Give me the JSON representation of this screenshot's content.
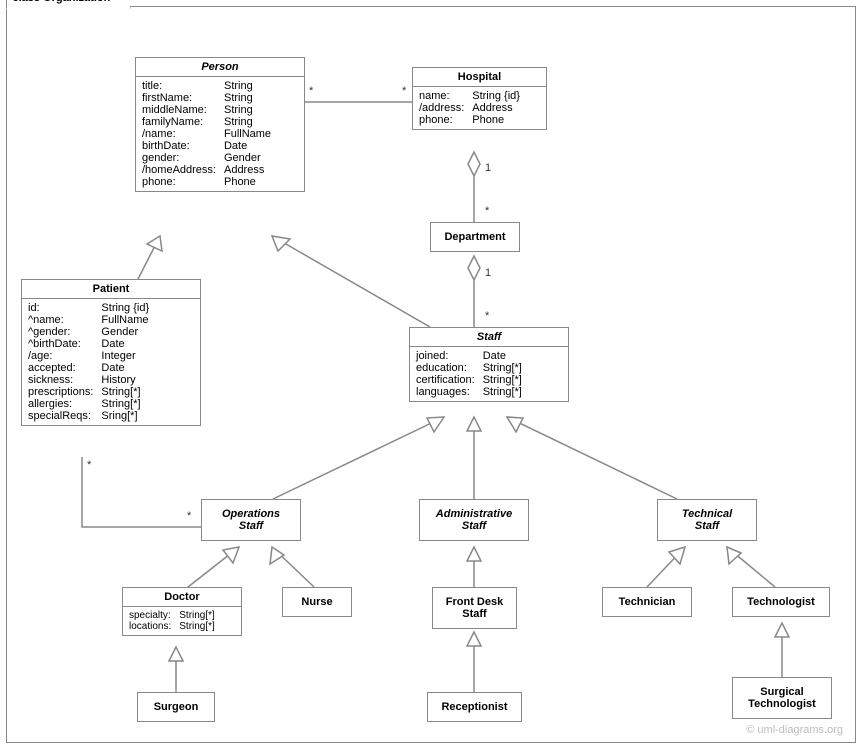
{
  "package_label": "class Organization",
  "watermark": "© uml-diagrams.org",
  "classes": {
    "person": {
      "title": "Person",
      "attr_names": "title:\nfirstName:\nmiddleName:\nfamilyName:\n/name:\nbirthDate:\ngender:\n/homeAddress:\nphone:",
      "attr_types": "String\nString\nString\nString\nFullName\nDate\nGender\nAddress\nPhone"
    },
    "hospital": {
      "title": "Hospital",
      "attr_names": "name:\n/address:\nphone:",
      "attr_types": "String {id}\nAddress\nPhone"
    },
    "department": {
      "title": "Department"
    },
    "patient": {
      "title": "Patient",
      "attr_names": "id:\n^name:\n^gender:\n^birthDate:\n/age:\naccepted:\nsickness:\nprescriptions:\nallergies:\nspecialReqs:",
      "attr_types": "String {id}\nFullName\nGender\nDate\nInteger\nDate\nHistory\nString[*]\nString[*]\nSring[*]"
    },
    "staff": {
      "title": "Staff",
      "attr_names": "joined:\neducation:\ncertification:\nlanguages:",
      "attr_types": "Date\nString[*]\nString[*]\nString[*]"
    },
    "ops_staff": {
      "title": "Operations\nStaff"
    },
    "admin_staff": {
      "title": "Administrative\nStaff"
    },
    "tech_staff": {
      "title": "Technical\nStaff"
    },
    "doctor": {
      "title": "Doctor",
      "attr_names": "specialty:\nlocations:",
      "attr_types": "String[*]\nString[*]"
    },
    "nurse": {
      "title": "Nurse"
    },
    "front_desk": {
      "title": "Front Desk\nStaff"
    },
    "receptionist": {
      "title": "Receptionist"
    },
    "technician": {
      "title": "Technician"
    },
    "technologist": {
      "title": "Technologist"
    },
    "surgeon": {
      "title": "Surgeon"
    },
    "surg_tech": {
      "title": "Surgical\nTechnologist"
    }
  },
  "multiplicities": {
    "person_hosp_left": "*",
    "person_hosp_right": "*",
    "hosp_dept_top": "1",
    "hosp_dept_bottom": "*",
    "dept_staff_top": "1",
    "dept_staff_bottom": "*",
    "patient_ops_left": "*",
    "patient_ops_right": "*"
  }
}
